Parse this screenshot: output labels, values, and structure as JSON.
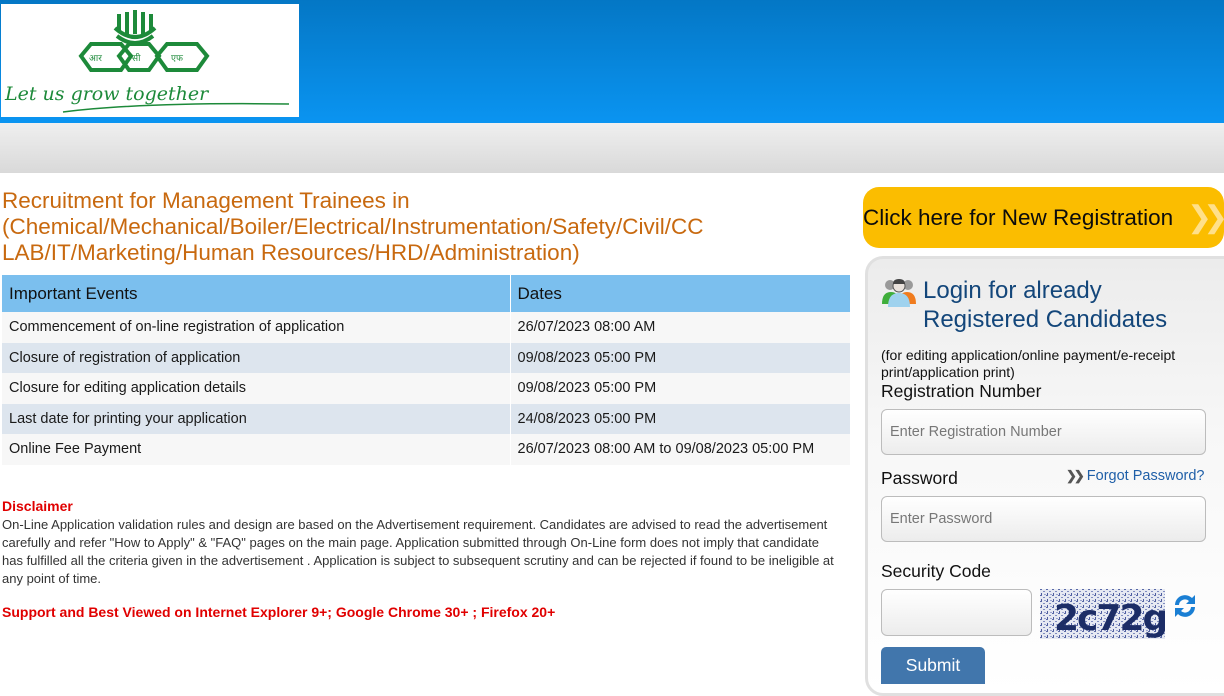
{
  "header": {
    "logo_alt": "RCF logo",
    "logo_devanagari": [
      "आर",
      "सी",
      "एफ"
    ],
    "logo_tagline": "Let us grow together"
  },
  "main": {
    "title": "Recruitment for Management Trainees in (Chemical/Mechanical/Boiler/Electrical/Instrumentation/Safety/Civil/CC LAB/IT/Marketing/Human Resources/HRD/Administration)",
    "table": {
      "headers": [
        "Important Events",
        "Dates"
      ],
      "rows": [
        {
          "event": "Commencement of on-line registration of application",
          "date": "26/07/2023 08:00 AM"
        },
        {
          "event": "Closure of registration of application",
          "date": "09/08/2023 05:00 PM"
        },
        {
          "event": "Closure for editing application details",
          "date": "09/08/2023 05:00 PM"
        },
        {
          "event": "Last date for printing your application",
          "date": "24/08/2023 05:00 PM"
        },
        {
          "event": "Online Fee Payment",
          "date": "26/07/2023 08:00 AM to 09/08/2023 05:00 PM"
        }
      ]
    },
    "disclaimer": {
      "title": "Disclaimer",
      "text": "On-Line Application validation rules and design are based on the Advertisement requirement. Candidates are advised to read the advertisement carefully and refer \"How to Apply\" & \"FAQ\" pages on the main page. Application submitted through On-Line form does not imply that candidate has fulfilled all the criteria given in the advertisement . Application is subject to subsequent scrutiny and can be rejected if found to be ineligible at any point of time."
    },
    "support_note": "Support and Best Viewed on Internet Explorer 9+; Google Chrome 30+ ; Firefox 20+"
  },
  "sidebar": {
    "new_registration_label": "Click here for New Registration",
    "new_registration_icon": "double-chevron-right",
    "login": {
      "heading_line1": "Login for already",
      "heading_line2": "Registered Candidates",
      "icon": "users-group-icon",
      "subtext": "(for editing application/online payment/e-receipt print/application print)",
      "registration_label": "Registration Number",
      "registration_placeholder": "Enter Registration Number",
      "registration_value": "",
      "password_label": "Password",
      "password_placeholder": "Enter Password",
      "password_value": "",
      "forgot_label": "Forgot Password?",
      "security_label": "Security Code",
      "security_value": "",
      "captcha_text": "2c72g",
      "submit_label": "Submit"
    }
  },
  "colors": {
    "header_blue_top": "#0477c5",
    "header_blue_bottom": "#0a94f1",
    "title_orange": "#c8690f",
    "table_header": "#7bbfee",
    "row_even": "#dde5ee",
    "row_odd": "#f7f7f7",
    "disclaimer_red": "#e00000",
    "new_reg_yellow": "#fbbd00",
    "login_heading": "#13467a",
    "link_blue": "#1f5fa8",
    "submit_blue": "#4176ac"
  }
}
